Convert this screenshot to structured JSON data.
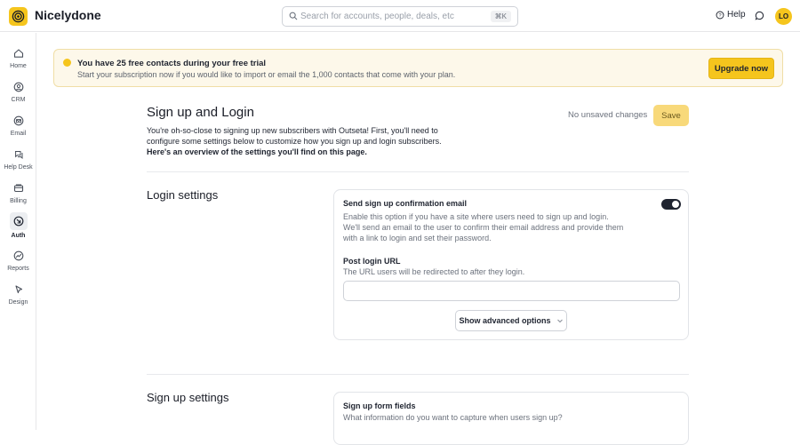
{
  "app": {
    "brand": "Nicelydone",
    "avatar_initials": "LO"
  },
  "search": {
    "placeholder": "Search for accounts, people, deals, etc",
    "shortcut": "⌘K"
  },
  "header": {
    "help_label": "Help"
  },
  "sidebar": {
    "items": [
      {
        "label": "Home",
        "icon": "home-icon"
      },
      {
        "label": "CRM",
        "icon": "crm-icon"
      },
      {
        "label": "Email",
        "icon": "email-icon"
      },
      {
        "label": "Help Desk",
        "icon": "help-desk-icon"
      },
      {
        "label": "Billing",
        "icon": "billing-icon"
      },
      {
        "label": "Auth",
        "icon": "auth-icon",
        "active": true
      },
      {
        "label": "Reports",
        "icon": "reports-icon"
      },
      {
        "label": "Design",
        "icon": "design-icon"
      }
    ]
  },
  "banner": {
    "title": "You have 25 free contacts during your free trial",
    "text": "Start your subscription now if you would like to import or email the 1,000 contacts that come with your plan.",
    "button": "Upgrade now"
  },
  "page": {
    "title": "Sign up and Login",
    "intro_plain": "You're oh-so-close to signing up new subscribers with Outseta! First, you'll need to configure some settings below to customize how you sign up and login subscribers. ",
    "intro_bold": "Here's an overview of the settings you'll find on this page.",
    "unsaved": "No unsaved changes",
    "save": "Save"
  },
  "login_settings": {
    "title": "Login settings",
    "confirm_email": {
      "label": "Send sign up confirmation email",
      "description": "Enable this option if you have a site where users need to sign up and login. We'll send an email to the user to confirm their email address and provide them with a link to login and set their password.",
      "enabled": true
    },
    "post_login_url": {
      "label": "Post login URL",
      "description": "The URL users will be redirected to after they login.",
      "value": ""
    },
    "advanced_button": "Show advanced options"
  },
  "signup_settings": {
    "title": "Sign up settings",
    "form_fields": {
      "label": "Sign up form fields",
      "description": "What information do you want to capture when users sign up?"
    }
  },
  "colors": {
    "accent": "#f5c51d",
    "banner_bg": "#fdf8ea"
  }
}
